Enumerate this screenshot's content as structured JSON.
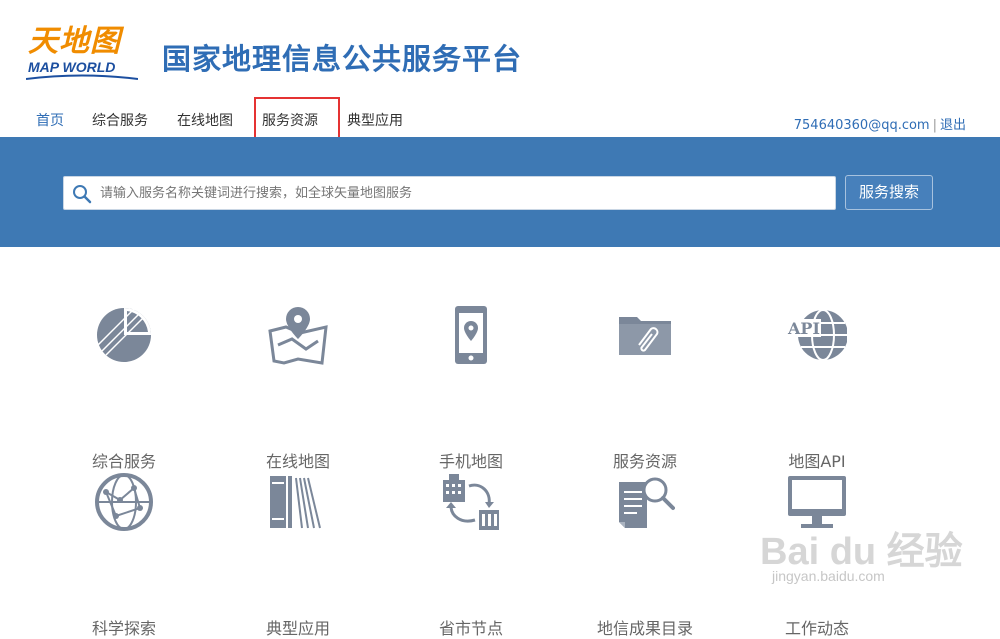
{
  "header": {
    "logo_cn": "天地图",
    "logo_en": "MAP WORLD",
    "title": "国家地理信息公共服务平台"
  },
  "nav": {
    "items": [
      {
        "label": "首页",
        "active": true
      },
      {
        "label": "综合服务",
        "active": false
      },
      {
        "label": "在线地图",
        "active": false
      },
      {
        "label": "服务资源",
        "active": false,
        "highlighted": true
      },
      {
        "label": "典型应用",
        "active": false
      }
    ],
    "user_email": "754640360@qq.com",
    "separator": "|",
    "logout": "退出"
  },
  "search": {
    "placeholder": "请输入服务名称关键词进行搜索，如全球矢量地图服务",
    "button_label": "服务搜索"
  },
  "tiles": [
    {
      "label": "综合服务",
      "icon": "pie-chart-icon"
    },
    {
      "label": "在线地图",
      "icon": "map-pin-icon"
    },
    {
      "label": "手机地图",
      "icon": "mobile-map-icon"
    },
    {
      "label": "服务资源",
      "icon": "folder-clip-icon"
    },
    {
      "label": "地图API",
      "icon": "api-globe-icon"
    },
    {
      "label": "科学探索",
      "icon": "network-globe-icon"
    },
    {
      "label": "典型应用",
      "icon": "books-icon"
    },
    {
      "label": "省市节点",
      "icon": "city-exchange-icon"
    },
    {
      "label": "地信成果目录",
      "icon": "document-search-icon"
    },
    {
      "label": "工作动态",
      "icon": "monitor-icon"
    }
  ],
  "watermark": {
    "logo": "Bai du 经验",
    "url": "jingyan.baidu.com"
  },
  "colors": {
    "brand_blue": "#2f6db5",
    "banner_blue": "#3e79b4",
    "logo_orange": "#f08c00",
    "icon_gray": "#7b8799",
    "highlight_red": "#e53333"
  }
}
